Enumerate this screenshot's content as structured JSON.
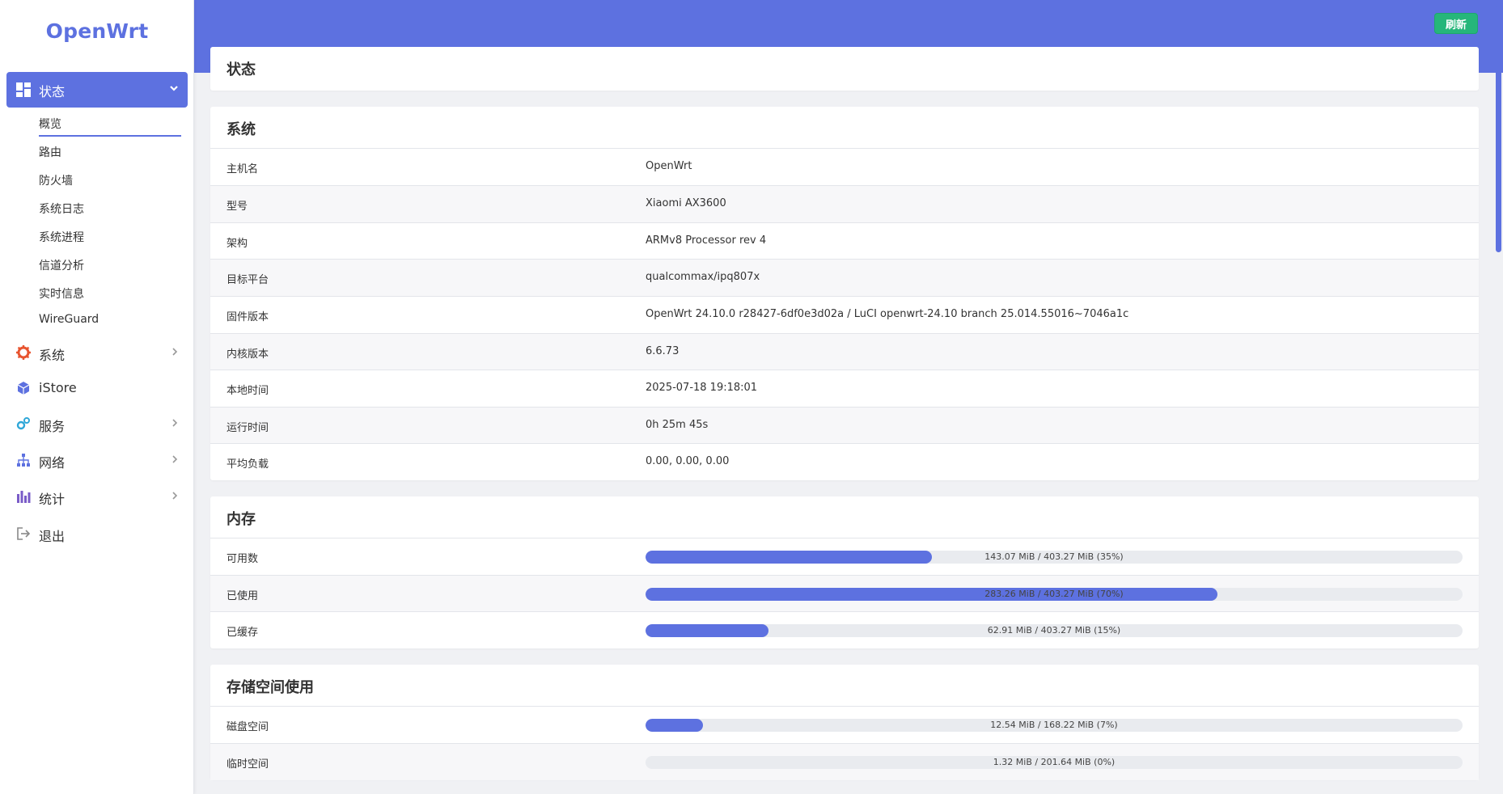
{
  "app": {
    "logo": "OpenWrt"
  },
  "sidebar": {
    "active": {
      "label": "状态"
    },
    "sub_items": [
      {
        "label": "概览"
      },
      {
        "label": "路由"
      },
      {
        "label": "防火墙"
      },
      {
        "label": "系统日志"
      },
      {
        "label": "系统进程"
      },
      {
        "label": "信道分析"
      },
      {
        "label": "实时信息"
      },
      {
        "label": "WireGuard"
      }
    ],
    "items": [
      {
        "label": "系统",
        "icon": "gear-icon",
        "color": "#e8542f"
      },
      {
        "label": "iStore",
        "icon": "cube-icon",
        "color": "#5d71e0"
      },
      {
        "label": "服务",
        "icon": "cogs-icon",
        "color": "#2fa7d8"
      },
      {
        "label": "网络",
        "icon": "network-icon",
        "color": "#5d71e0"
      },
      {
        "label": "统计",
        "icon": "bar-chart-icon",
        "color": "#7a5cc8"
      },
      {
        "label": "退出",
        "icon": "logout-icon",
        "color": "#888"
      }
    ]
  },
  "topbar": {
    "refresh_label": "刷新"
  },
  "page": {
    "title": "状态"
  },
  "system": {
    "title": "系统",
    "rows": [
      {
        "key": "主机名",
        "value": "OpenWrt"
      },
      {
        "key": "型号",
        "value": "Xiaomi AX3600"
      },
      {
        "key": "架构",
        "value": "ARMv8 Processor rev 4"
      },
      {
        "key": "目标平台",
        "value": "qualcommax/ipq807x"
      },
      {
        "key": "固件版本",
        "value": "OpenWrt 24.10.0 r28427-6df0e3d02a / LuCI openwrt-24.10 branch 25.014.55016~7046a1c"
      },
      {
        "key": "内核版本",
        "value": "6.6.73"
      },
      {
        "key": "本地时间",
        "value": "2025-07-18 19:18:01"
      },
      {
        "key": "运行时间",
        "value": "0h 25m 45s"
      },
      {
        "key": "平均负载",
        "value": "0.00, 0.00, 0.00"
      }
    ]
  },
  "memory": {
    "title": "内存",
    "rows": [
      {
        "key": "可用数",
        "text": "143.07 MiB / 403.27 MiB (35%)",
        "percent": 35
      },
      {
        "key": "已使用",
        "text": "283.26 MiB / 403.27 MiB (70%)",
        "percent": 70
      },
      {
        "key": "已缓存",
        "text": "62.91 MiB / 403.27 MiB (15%)",
        "percent": 15
      }
    ]
  },
  "storage": {
    "title": "存储空间使用",
    "rows": [
      {
        "key": "磁盘空间",
        "text": "12.54 MiB / 168.22 MiB (7%)",
        "percent": 7
      },
      {
        "key": "临时空间",
        "text": "1.32 MiB / 201.64 MiB (0%)",
        "percent": 0
      }
    ]
  },
  "colors": {
    "accent": "#5d71e0",
    "refresh": "#26b67a"
  }
}
